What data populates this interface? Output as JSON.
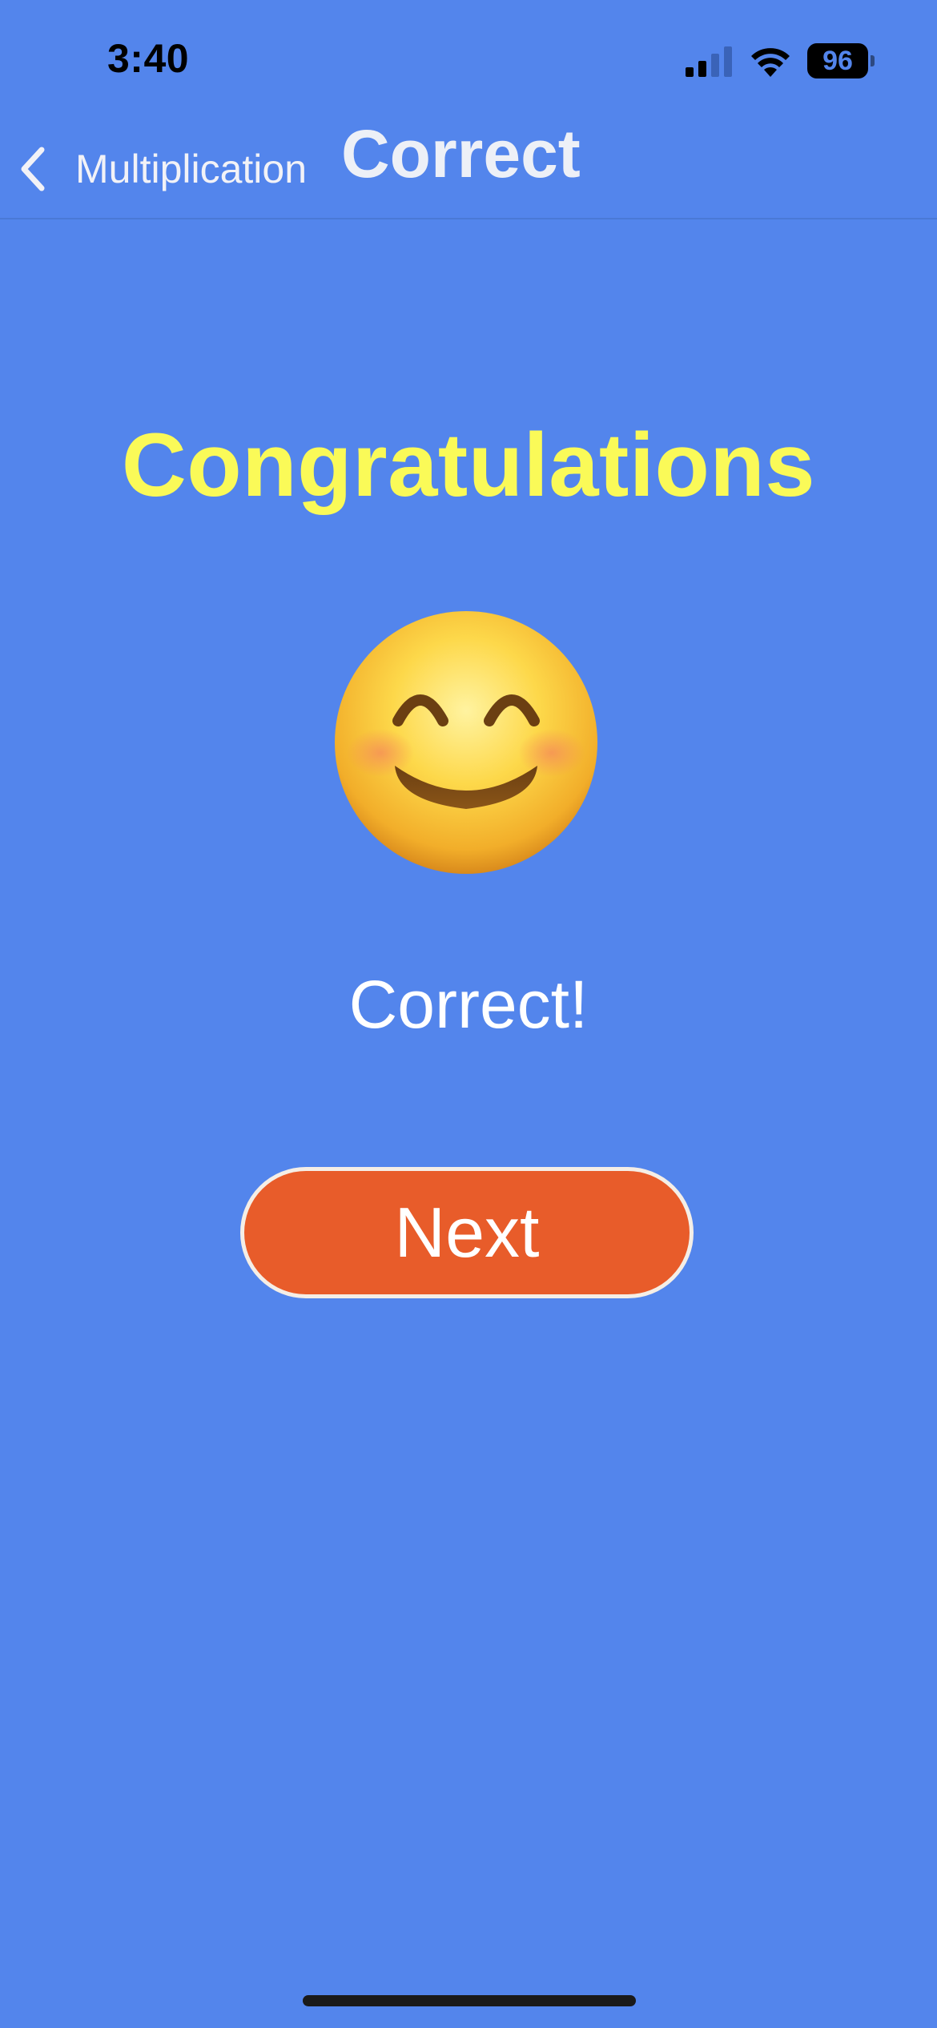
{
  "status_bar": {
    "time": "3:40",
    "battery_level": "96",
    "signal_icon": "cellular-signal-icon",
    "wifi_icon": "wifi-icon"
  },
  "nav": {
    "back_icon": "chevron-left-icon",
    "back_label": "Multiplication",
    "title": "Correct"
  },
  "content": {
    "headline": "Congratulations",
    "emoji_icon": "smiling-face-icon",
    "result": "Correct!",
    "next_label": "Next"
  },
  "colors": {
    "background": "#5385EC",
    "headline": "#FAFA58",
    "button": "#E85C2A"
  }
}
